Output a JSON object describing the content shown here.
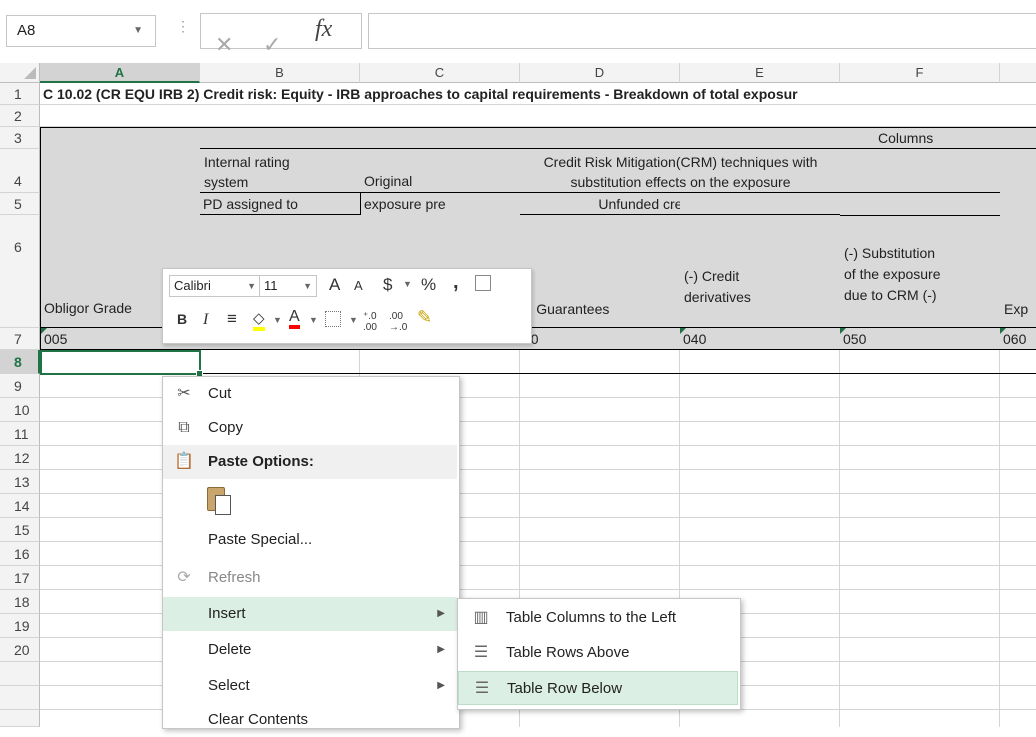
{
  "formula_bar": {
    "name_box": "A8",
    "cancel_icon": "✕",
    "enter_icon": "✓",
    "fx_label": "fx",
    "formula": ""
  },
  "columns": [
    "A",
    "B",
    "C",
    "D",
    "E",
    "F"
  ],
  "rows": [
    "1",
    "2",
    "3",
    "4",
    "5",
    "6",
    "7",
    "8",
    "9",
    "10",
    "11",
    "12",
    "13",
    "14",
    "15",
    "16",
    "17",
    "18",
    "19",
    "20"
  ],
  "cells": {
    "title": "C 10.02 (CR EQU IRB 2) Credit risk: Equity - IRB approaches to capital requirements - Breakdown of total exposur",
    "columns_label": "Columns",
    "b4_line1": "Internal rating",
    "b4_line2": "system",
    "b5": "PD assigned to",
    "c4": "Original",
    "c5": "exposure pre",
    "crm_line1": "Credit Risk Mitigation(CRM) techniques with",
    "crm_line2": "substitution effects on the exposure",
    "unfunded": "Unfunded credit protection",
    "f5": "(-) Substitution",
    "f6a": "of the exposure",
    "f6b": "due to CRM (-)",
    "e6a": "(-) Credit",
    "e6b": "derivatives",
    "d6": "-) Guarantees",
    "a6": "Obligor Grade",
    "g6": "Exp",
    "a7": "005",
    "d7": "30",
    "e7": "040",
    "f7": "050",
    "g7": "060"
  },
  "mini_toolbar": {
    "font": "Calibri",
    "size": "11",
    "bold": "B",
    "italic": "I",
    "grow": "A",
    "shrink": "A",
    "currency": "$",
    "percent": "%",
    "comma": ",",
    "font_color_glyph": "A"
  },
  "context_menu": {
    "cut": "Cut",
    "copy": "Copy",
    "paste_options": "Paste Options:",
    "paste_special": "Paste Special...",
    "refresh": "Refresh",
    "insert": "Insert",
    "delete": "Delete",
    "select": "Select",
    "clear_contents": "Clear Contents"
  },
  "submenu": {
    "cols_left": "Table Columns to the Left",
    "rows_above": "Table Rows Above",
    "row_below": "Table Row Below"
  },
  "colors": {
    "accent": "#217346",
    "highlight": "#dcefe4",
    "header_gray": "#d9d9d9"
  }
}
